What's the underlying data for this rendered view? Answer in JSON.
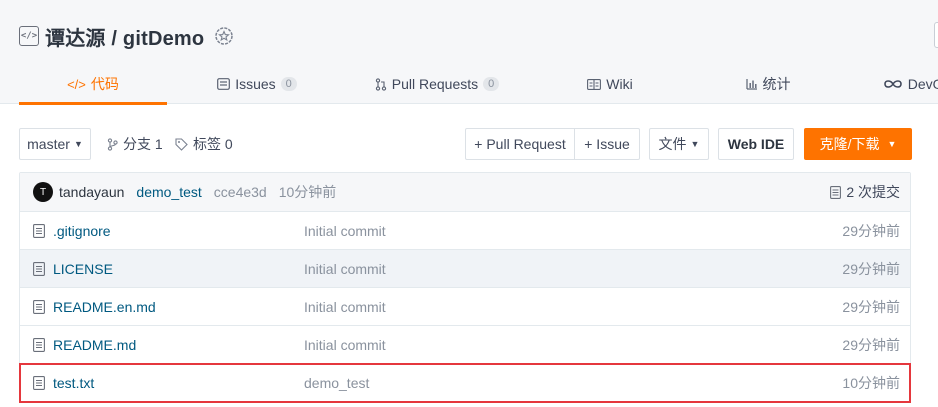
{
  "repo": {
    "owner": "谭达源",
    "separator": "/",
    "name": "gitDemo"
  },
  "tabs": [
    {
      "label": "代码",
      "icon": "code-icon",
      "active": true
    },
    {
      "label": "Issues",
      "count": "0",
      "icon": "issues-icon"
    },
    {
      "label": "Pull Requests",
      "count": "0",
      "icon": "pull-request-icon"
    },
    {
      "label": "Wiki",
      "icon": "wiki-icon"
    },
    {
      "label": "统计",
      "icon": "stats-icon"
    },
    {
      "label": "DevOps",
      "icon": "devops-icon"
    }
  ],
  "toolbar": {
    "branch": "master",
    "branches_label": "分支 1",
    "tags_label": "标签 0",
    "pull_request_label": "+ Pull Request",
    "issue_label": "+ Issue",
    "files_label": "文件",
    "web_ide_label": "Web IDE",
    "clone_label": "克隆/下载"
  },
  "latest_commit": {
    "avatar_letter": "T",
    "author": "tandayaun",
    "message": "demo_test",
    "sha": "cce4e3d",
    "time": "10分钟前",
    "commits_label": "2 次提交"
  },
  "files": [
    {
      "name": ".gitignore",
      "message": "Initial commit",
      "time": "29分钟前"
    },
    {
      "name": "LICENSE",
      "message": "Initial commit",
      "time": "29分钟前"
    },
    {
      "name": "README.en.md",
      "message": "Initial commit",
      "time": "29分钟前"
    },
    {
      "name": "README.md",
      "message": "Initial commit",
      "time": "29分钟前"
    },
    {
      "name": "test.txt",
      "message": "demo_test",
      "time": "10分钟前",
      "highlighted": true
    }
  ],
  "colors": {
    "accent": "#fe7300",
    "highlight_border": "#e5373d",
    "link": "#005980"
  }
}
